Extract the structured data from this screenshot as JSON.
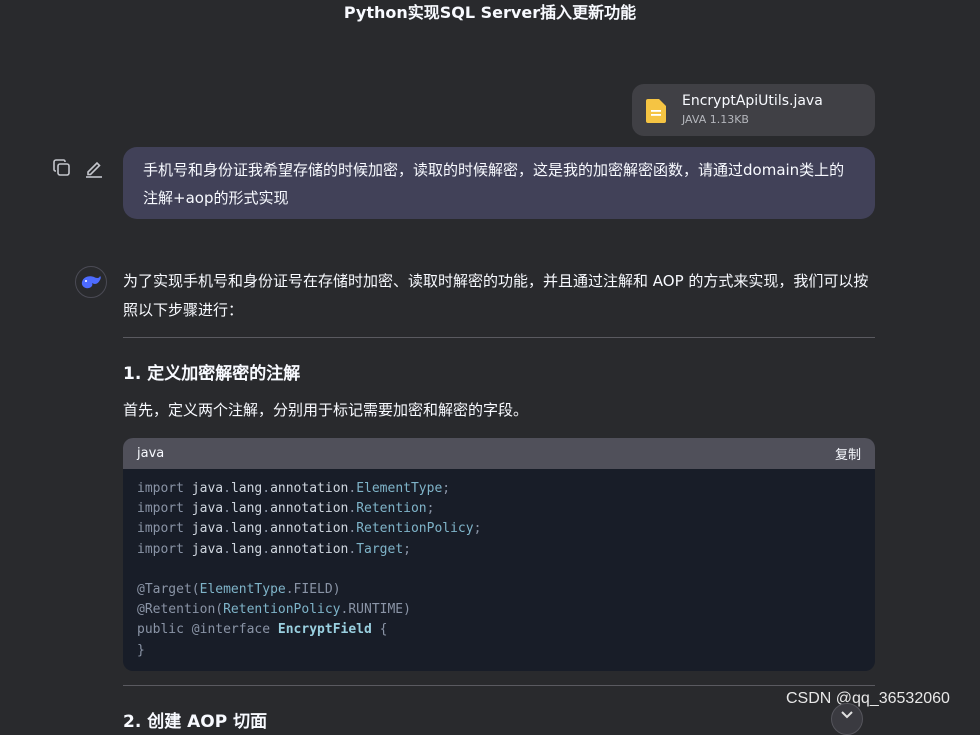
{
  "header": {
    "title": "Python实现SQL Server插入更新功能"
  },
  "attachment": {
    "filename": "EncryptApiUtils.java",
    "meta": "JAVA 1.13KB",
    "icon": "file-icon"
  },
  "user_message": {
    "text": "手机号和身份证我希望存储的时候加密，读取的时候解密，这是我的加密解密函数，请通过domain类上的注解+aop的形式实现",
    "actions": [
      "copy-icon",
      "edit-icon"
    ]
  },
  "answer": {
    "intro": "为了实现手机号和身份证号在存储时加密、读取时解密的功能，并且通过注解和 AOP 的方式来实现，我们可以按照以下步骤进行：",
    "section1_title": "1. 定义加密解密的注解",
    "section1_text": "首先，定义两个注解，分别用于标记需要加密和解密的字段。",
    "section2_title": "2. 创建 AOP 切面"
  },
  "code_block": {
    "language": "java",
    "copy_label": "复制",
    "lines": [
      "import java.lang.annotation.ElementType;",
      "import java.lang.annotation.Retention;",
      "import java.lang.annotation.RetentionPolicy;",
      "import java.lang.annotation.Target;",
      "",
      "@Target(ElementType.FIELD)",
      "@Retention(RetentionPolicy.RUNTIME)",
      "public @interface EncryptField {",
      "}"
    ]
  },
  "watermark": "CSDN @qq_36532060",
  "colors": {
    "background": "#292a2d",
    "user_bubble": "#414158",
    "code_bg": "#181d28",
    "file_icon": "#f5c443"
  }
}
